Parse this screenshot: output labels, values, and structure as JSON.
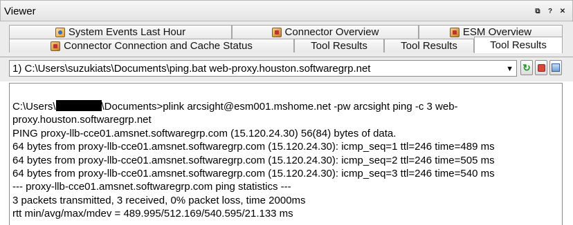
{
  "window": {
    "title": "Viewer",
    "controls": [
      "restore",
      "?",
      "close"
    ]
  },
  "tabs": {
    "row1": [
      {
        "label": "System Events Last Hour",
        "icon": "dashboard-icon"
      },
      {
        "label": "Connector Overview",
        "icon": "dashboard-icon"
      },
      {
        "label": "ESM Overview",
        "icon": "dashboard-icon"
      }
    ],
    "row2": [
      {
        "label": "Connector Connection and Cache Status",
        "icon": "dashboard-icon"
      },
      {
        "label": "Tool Results"
      },
      {
        "label": "Tool Results"
      },
      {
        "label": "Tool Results",
        "active": true
      }
    ]
  },
  "toolbar": {
    "selected": "1) C:\\Users\\suzukiats\\Documents\\ping.bat web-proxy.houston.softwaregrp.net"
  },
  "output": {
    "cmd_prefix": "C:\\Users\\",
    "cmd_suffix": "\\Documents>plink arcsight@esm001.mshome.net -pw arcsight ping -c 3 web-proxy.houston.softwaregrp.net",
    "lines": [
      "PING proxy-llb-cce01.amsnet.softwaregrp.com (15.120.24.30) 56(84) bytes of data.",
      "64 bytes from proxy-llb-cce01.amsnet.softwaregrp.com (15.120.24.30): icmp_seq=1 ttl=246 time=489 ms",
      "64 bytes from proxy-llb-cce01.amsnet.softwaregrp.com (15.120.24.30): icmp_seq=2 ttl=246 time=505 ms",
      "64 bytes from proxy-llb-cce01.amsnet.softwaregrp.com (15.120.24.30): icmp_seq=3 ttl=246 time=540 ms",
      "--- proxy-llb-cce01.amsnet.softwaregrp.com ping statistics ---",
      "3 packets transmitted, 3 received, 0% packet loss, time 2000ms",
      "rtt min/avg/max/mdev = 489.995/512.169/540.595/21.133 ms"
    ]
  }
}
